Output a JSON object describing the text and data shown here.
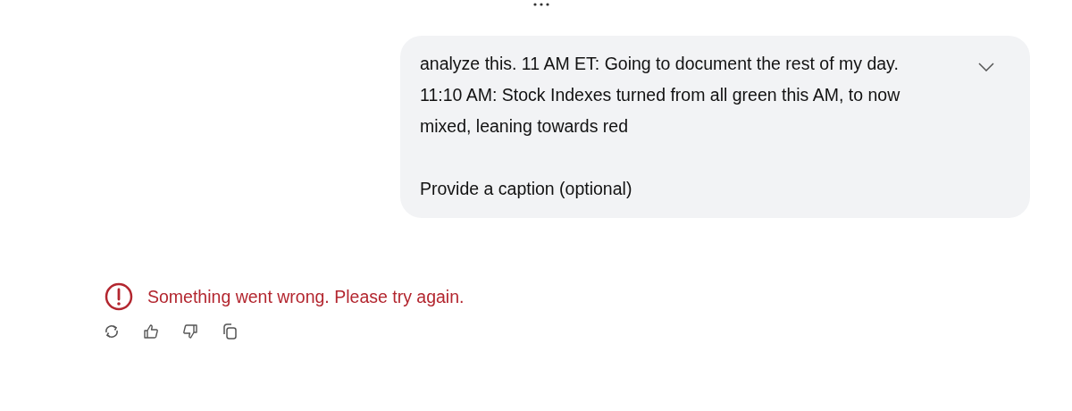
{
  "message": {
    "lines": [
      "analyze this. 11 AM ET: Going to document the rest of my day.",
      "11:10 AM: Stock Indexes turned from all green this AM, to now",
      "mixed, leaning towards red"
    ],
    "caption": "Provide a caption (optional)",
    "expanded": false
  },
  "error": {
    "text": "Something went wrong. Please try again."
  },
  "actions": [
    {
      "kind": "retry"
    },
    {
      "kind": "like"
    },
    {
      "kind": "dislike"
    },
    {
      "kind": "copy"
    }
  ]
}
